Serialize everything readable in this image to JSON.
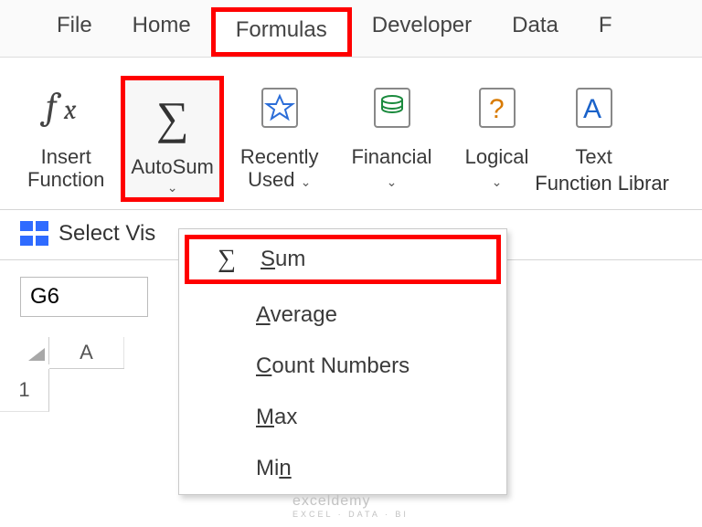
{
  "tabs": {
    "file": "File",
    "home": "Home",
    "formulas": "Formulas",
    "developer": "Developer",
    "data": "Data",
    "partial": "F"
  },
  "ribbon": {
    "insert_function_line1": "Insert",
    "insert_function_line2": "Function",
    "autosum": "AutoSum",
    "recently_line1": "Recently",
    "recently_line2": "Used",
    "financial": "Financial",
    "logical": "Logical",
    "text": "Text",
    "library_label": "Function Librar"
  },
  "select_visible": "Select Vis",
  "name_box": "G6",
  "columns": {
    "a": "A"
  },
  "rows": {
    "r1": "1"
  },
  "autosum_menu": {
    "sum_s": "S",
    "sum_rest": "um",
    "avg_a": "A",
    "avg_rest": "verage",
    "cnt_c": "C",
    "cnt_rest": "ount Numbers",
    "max_m": "M",
    "max_rest": "ax",
    "min_mi": "Mi",
    "min_n": "n"
  },
  "watermark": {
    "brand": "exceldemy",
    "tagline": "EXCEL · DATA · BI"
  }
}
